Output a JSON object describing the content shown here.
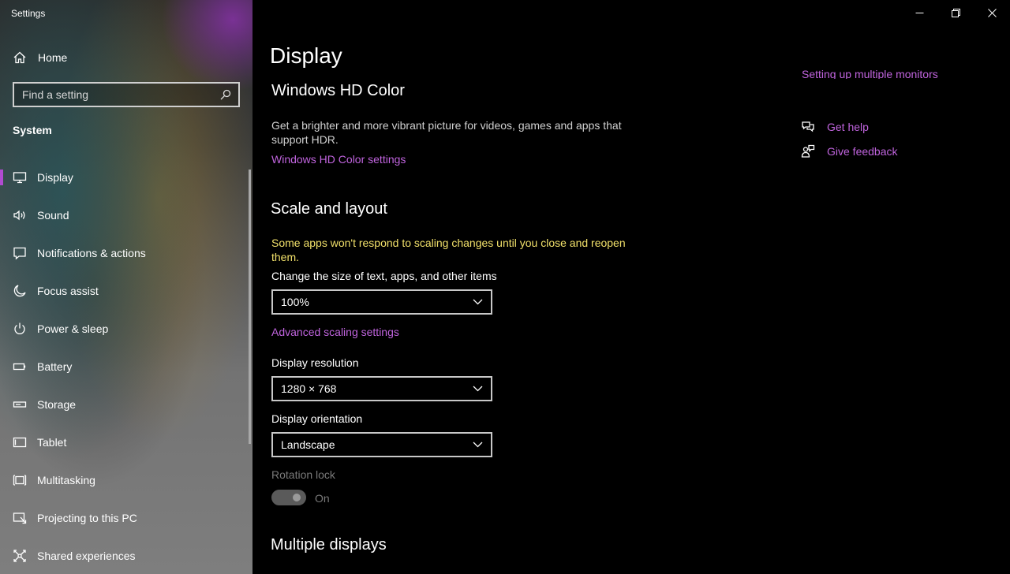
{
  "app": {
    "title": "Settings"
  },
  "sidebar": {
    "home_label": "Home",
    "search_placeholder": "Find a setting",
    "section_title": "System",
    "items": [
      {
        "label": "Display",
        "icon": "monitor-icon"
      },
      {
        "label": "Sound",
        "icon": "speaker-icon"
      },
      {
        "label": "Notifications & actions",
        "icon": "notification-icon"
      },
      {
        "label": "Focus assist",
        "icon": "moon-icon"
      },
      {
        "label": "Power & sleep",
        "icon": "power-icon"
      },
      {
        "label": "Battery",
        "icon": "battery-icon"
      },
      {
        "label": "Storage",
        "icon": "storage-icon"
      },
      {
        "label": "Tablet",
        "icon": "tablet-icon"
      },
      {
        "label": "Multitasking",
        "icon": "multitasking-icon"
      },
      {
        "label": "Projecting to this PC",
        "icon": "projecting-icon"
      },
      {
        "label": "Shared experiences",
        "icon": "shared-experiences-icon"
      }
    ],
    "active_index": 0
  },
  "main": {
    "page_title": "Display",
    "hdr": {
      "title": "Windows HD Color",
      "description": "Get a brighter and more vibrant picture for videos, games and apps that support HDR.",
      "link": "Windows HD Color settings"
    },
    "scale": {
      "title": "Scale and layout",
      "warning": "Some apps won't respond to scaling changes until you close and reopen them.",
      "size_label": "Change the size of text, apps, and other items",
      "size_value": "100%",
      "advanced_link": "Advanced scaling settings",
      "resolution_label": "Display resolution",
      "resolution_value": "1280 × 768",
      "orientation_label": "Display orientation",
      "orientation_value": "Landscape",
      "rotation_label": "Rotation lock",
      "rotation_state": "On"
    },
    "multiple": {
      "title": "Multiple displays"
    }
  },
  "related": {
    "cut_link": "Setting up multiple monitors",
    "get_help": "Get help",
    "give_feedback": "Give feedback"
  },
  "colors": {
    "accent": "#b14bd1",
    "link": "#c064de",
    "warning": "#f1e06a"
  }
}
